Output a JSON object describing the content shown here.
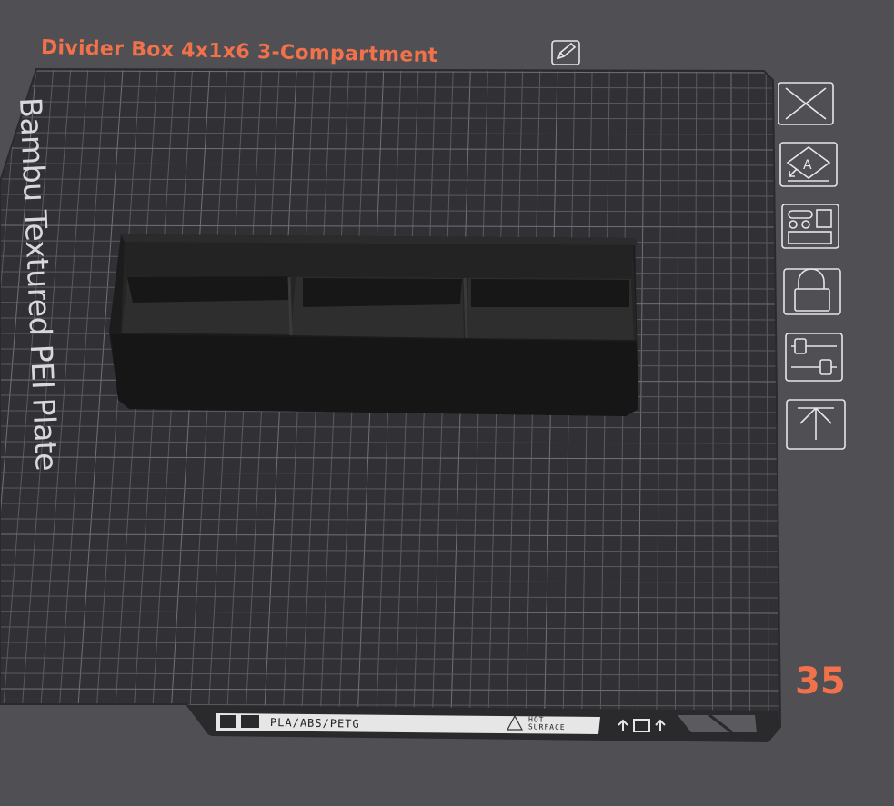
{
  "plate": {
    "title": "Divider Box 4x1x6 3-Compartment",
    "number": "35",
    "label": "Bambu Textured PEI Plate"
  },
  "bed_strip": {
    "materials": "PLA/ABS/PETG",
    "hot_surface": "HOT\nSURFACE"
  },
  "toolbar": [
    {
      "name": "close-plate",
      "icon": "close-icon"
    },
    {
      "name": "auto-orient",
      "icon": "auto-orient-icon"
    },
    {
      "name": "arrange",
      "icon": "arrange-icon"
    },
    {
      "name": "lock-plate",
      "icon": "lock-icon"
    },
    {
      "name": "plate-settings",
      "icon": "sliders-icon"
    },
    {
      "name": "move-to-top",
      "icon": "move-to-top-icon"
    }
  ],
  "colors": {
    "accent": "#f0714a",
    "background": "#4f4f54",
    "plate": "#313135",
    "grid_line": "#5b5b60",
    "model": "#1c1c1c"
  }
}
